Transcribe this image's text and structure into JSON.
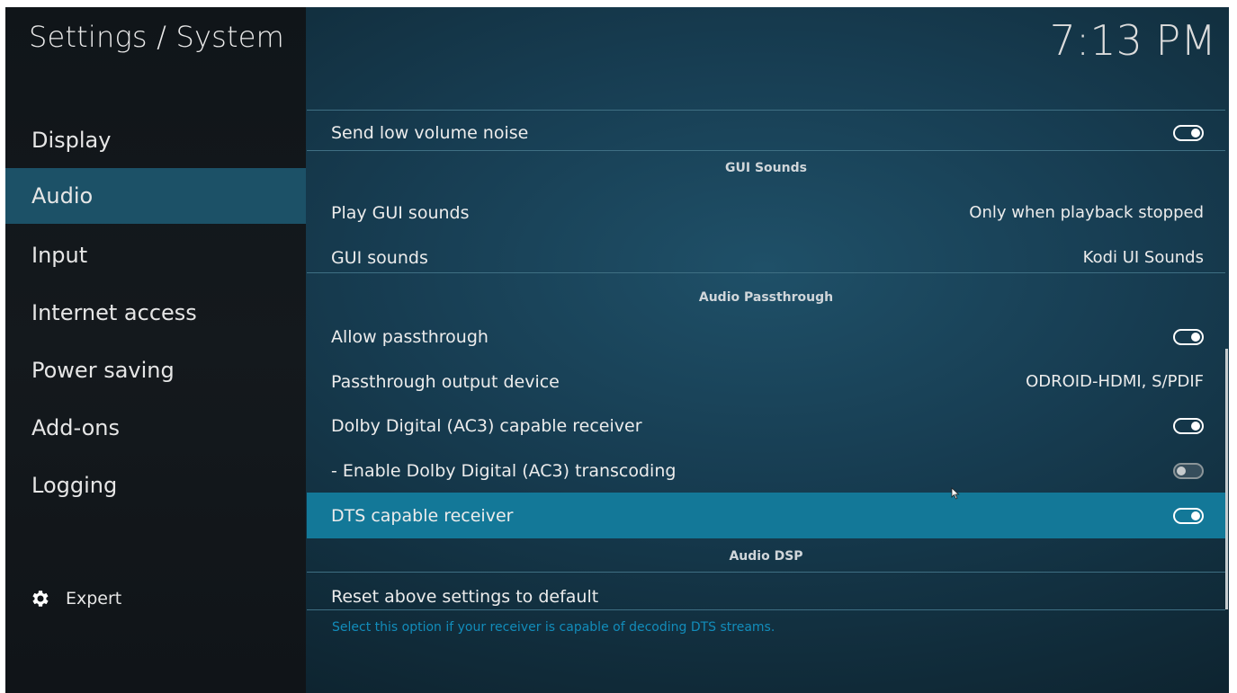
{
  "header": {
    "title": "Settings / System",
    "clock": "7:13 PM"
  },
  "sidebar": {
    "items": [
      {
        "label": "Display"
      },
      {
        "label": "Audio",
        "active": true
      },
      {
        "label": "Input"
      },
      {
        "label": "Internet access"
      },
      {
        "label": "Power saving"
      },
      {
        "label": "Add-ons"
      },
      {
        "label": "Logging"
      }
    ],
    "expert": {
      "icon": "gear-icon",
      "label": "Expert"
    }
  },
  "settings": {
    "send_low_volume_noise": {
      "label": "Send low volume noise",
      "toggle": "on"
    },
    "gui_sounds_header": "GUI Sounds",
    "play_gui_sounds": {
      "label": "Play GUI sounds",
      "value": "Only when playback stopped"
    },
    "gui_sounds": {
      "label": "GUI sounds",
      "value": "Kodi UI Sounds"
    },
    "audio_passthrough_header": "Audio Passthrough",
    "allow_passthrough": {
      "label": "Allow passthrough",
      "toggle": "on"
    },
    "passthrough_output_device": {
      "label": "Passthrough output device",
      "value": "ODROID-HDMI, S/PDIF"
    },
    "dolby_digital_receiver": {
      "label": "Dolby Digital (AC3) capable receiver",
      "toggle": "on"
    },
    "dolby_transcoding": {
      "label": "- Enable Dolby Digital (AC3) transcoding",
      "toggle": "off"
    },
    "dts_receiver": {
      "label": "DTS capable receiver",
      "toggle": "on",
      "focused": true
    },
    "audio_dsp_header": "Audio DSP",
    "reset_defaults": {
      "label": "Reset above settings to default"
    }
  },
  "description": "Select this option if your receiver is capable of decoding DTS streams.",
  "colors": {
    "accent": "#137898",
    "sidebar_active": "#1c5167",
    "description_text": "#128dbb"
  }
}
